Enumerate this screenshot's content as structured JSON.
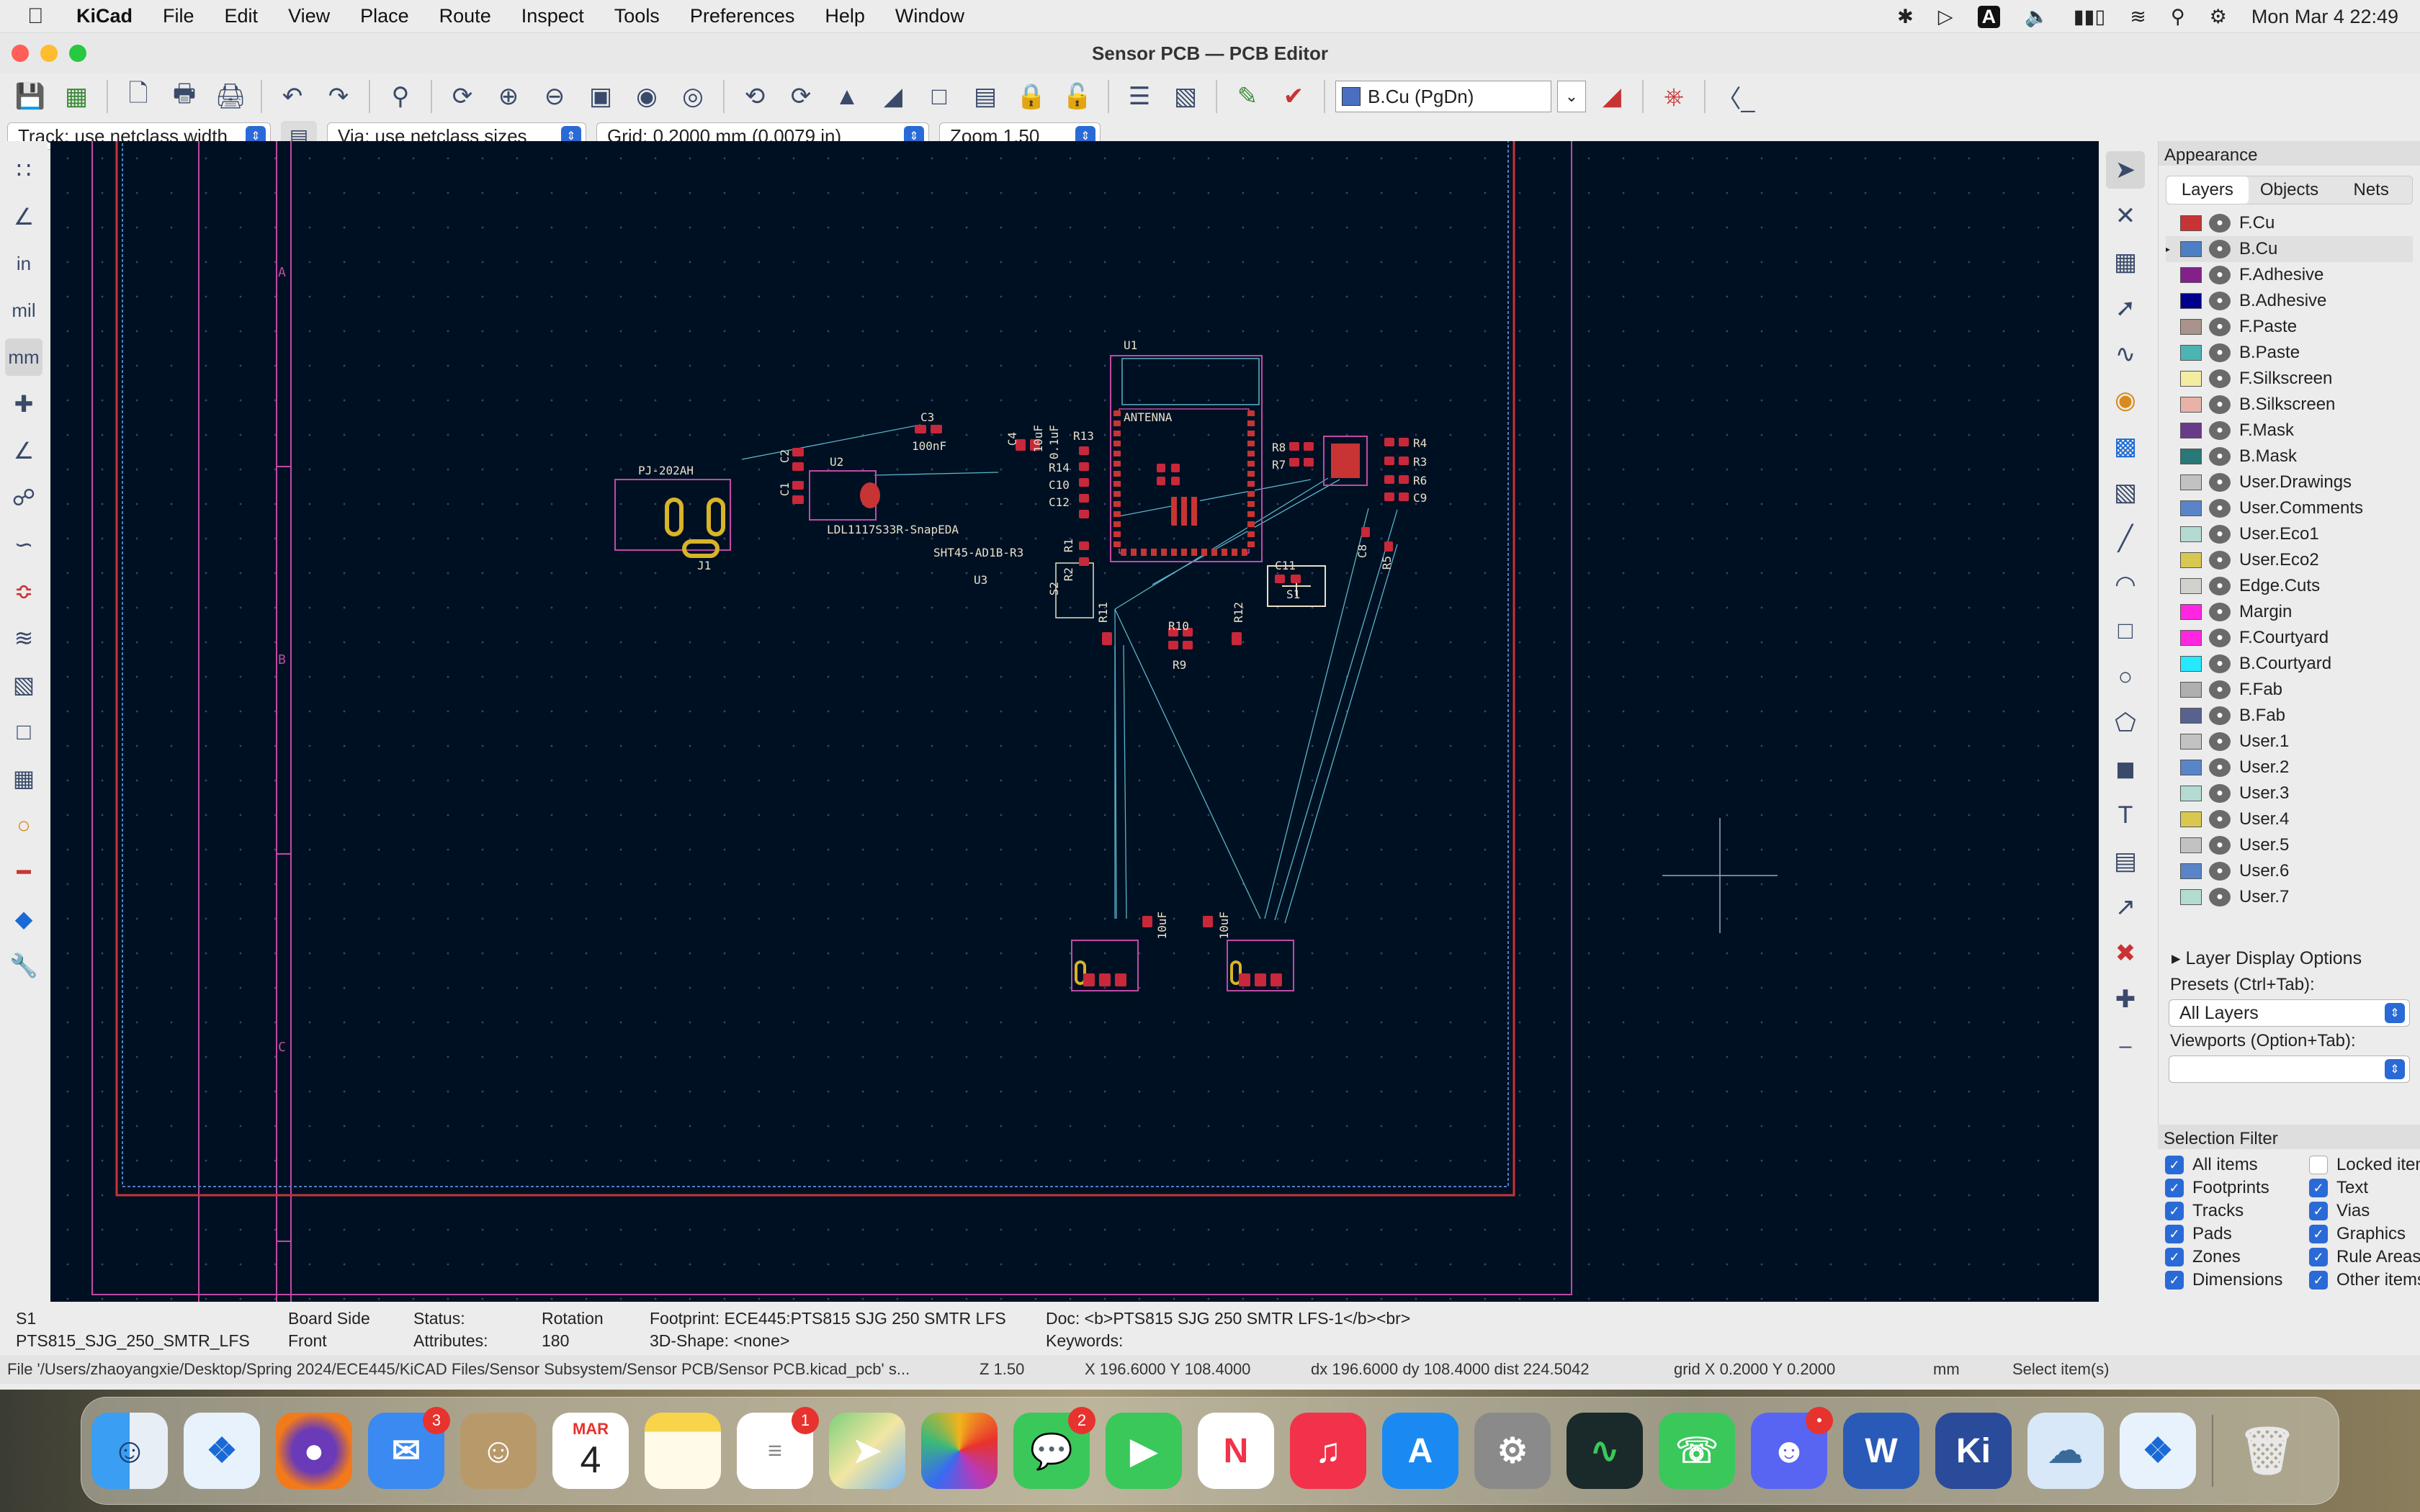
{
  "menubar": {
    "app_name": "KiCad",
    "items": [
      "File",
      "Edit",
      "View",
      "Place",
      "Route",
      "Inspect",
      "Tools",
      "Preferences",
      "Help",
      "Window"
    ],
    "input_indicator": "A",
    "clock": "Mon Mar 4  22:49"
  },
  "window": {
    "title": "Sensor PCB — PCB Editor"
  },
  "toolbar": {
    "active_layer": "B.Cu (PgDn)",
    "active_layer_color": "#4a6fc0"
  },
  "toolbar2": {
    "track": "Track: use netclass width",
    "via": "Via: use netclass sizes",
    "grid": "Grid: 0.2000 mm (0.0079 in)",
    "zoom": "Zoom 1.50"
  },
  "left_toolbar": {
    "unit_in": "in",
    "unit_mil": "mil",
    "unit_mm": "mm"
  },
  "canvas": {
    "sheet_markers": [
      "A",
      "B",
      "C"
    ],
    "labels": {
      "j1_value": "PJ-202AH",
      "j1_ref": "J1",
      "u2_ref": "U2",
      "u2_value": "LDL1117S33R-SnapEDA",
      "c2": "C2",
      "c1": "C1",
      "c3": "C3",
      "c3_value": "100nF",
      "u1": "U1",
      "antenna": "ANTENNA",
      "c4": "C4",
      "c4_value": "10uF",
      "c5_value": "0.1uF",
      "r13": "R13",
      "r14": "R14",
      "c10": "C10",
      "c12": "C12",
      "r1": "R1",
      "r2": "R2",
      "u3_value": "SHT45-AD1B-R3",
      "u3": "U3",
      "r8": "R8",
      "r7": "R7",
      "r4": "R4",
      "r3": "R3",
      "r6": "R6",
      "c9": "C9",
      "c8": "C8",
      "r5": "R5",
      "c11": "C11",
      "s1": "S1",
      "s2": "S2",
      "r11": "R11",
      "r10": "R10",
      "r9": "R9",
      "r12": "R12",
      "bottom_c1": "10uF",
      "bottom_c2": "10uF"
    }
  },
  "appearance": {
    "header": "Appearance",
    "tabs": [
      "Layers",
      "Objects",
      "Nets"
    ],
    "layers": [
      {
        "name": "F.Cu",
        "color": "#c83434"
      },
      {
        "name": "B.Cu",
        "color": "#4d7fc4"
      },
      {
        "name": "F.Adhesive",
        "color": "#84208a"
      },
      {
        "name": "B.Adhesive",
        "color": "#00008a"
      },
      {
        "name": "F.Paste",
        "color": "#a8948c"
      },
      {
        "name": "B.Paste",
        "color": "#4cb4b4"
      },
      {
        "name": "F.Silkscreen",
        "color": "#f2eda1"
      },
      {
        "name": "B.Silkscreen",
        "color": "#e8b2a7"
      },
      {
        "name": "F.Mask",
        "color": "#6a3a8a"
      },
      {
        "name": "B.Mask",
        "color": "#2a7878"
      },
      {
        "name": "User.Drawings",
        "color": "#c2c2c2"
      },
      {
        "name": "User.Comments",
        "color": "#5984c8"
      },
      {
        "name": "User.Eco1",
        "color": "#b4dbd2"
      },
      {
        "name": "User.Eco2",
        "color": "#d8c852"
      },
      {
        "name": "Edge.Cuts",
        "color": "#d0d2cd"
      },
      {
        "name": "Margin",
        "color": "#ff26e2"
      },
      {
        "name": "F.Courtyard",
        "color": "#ff26e2"
      },
      {
        "name": "B.Courtyard",
        "color": "#26e9ff"
      },
      {
        "name": "F.Fab",
        "color": "#afafaf"
      },
      {
        "name": "B.Fab",
        "color": "#58628f"
      },
      {
        "name": "User.1",
        "color": "#c2c2c2"
      },
      {
        "name": "User.2",
        "color": "#5984c8"
      },
      {
        "name": "User.3",
        "color": "#b4dbd2"
      },
      {
        "name": "User.4",
        "color": "#d8c852"
      },
      {
        "name": "User.5",
        "color": "#c2c2c2"
      },
      {
        "name": "User.6",
        "color": "#5984c8"
      },
      {
        "name": "User.7",
        "color": "#b4dbd2"
      }
    ],
    "layer_display_options": "Layer Display Options",
    "presets_label": "Presets (Ctrl+Tab):",
    "presets_value": "All Layers",
    "viewports_label": "Viewports (Option+Tab):",
    "viewports_value": ""
  },
  "selection_filter": {
    "header": "Selection Filter",
    "items": [
      {
        "label": "All items",
        "checked": true
      },
      {
        "label": "Locked items",
        "checked": false
      },
      {
        "label": "Footprints",
        "checked": true
      },
      {
        "label": "Text",
        "checked": true
      },
      {
        "label": "Tracks",
        "checked": true
      },
      {
        "label": "Vias",
        "checked": true
      },
      {
        "label": "Pads",
        "checked": true
      },
      {
        "label": "Graphics",
        "checked": true
      },
      {
        "label": "Zones",
        "checked": true
      },
      {
        "label": "Rule Areas",
        "checked": true
      },
      {
        "label": "Dimensions",
        "checked": true
      },
      {
        "label": "Other items",
        "checked": true
      }
    ]
  },
  "info": {
    "ref": "S1",
    "footprint_name": "PTS815_SJG_250_SMTR_LFS",
    "board_side_label": "Board Side",
    "board_side": "Front",
    "status_label": "Status:",
    "attributes_label": "Attributes:",
    "rotation_label": "Rotation",
    "rotation": "180",
    "footprint": "Footprint: ECE445:PTS815 SJG 250 SMTR LFS",
    "shape3d": "3D-Shape: <none>",
    "doc": "Doc: <b>PTS815 SJG 250 SMTR LFS-1</b><br>",
    "keywords": "Keywords:"
  },
  "statusbar": {
    "file": "File '/Users/zhaoyangxie/Desktop/Spring 2024/ECE445/KiCAD Files/Sensor Subsystem/Sensor PCB/Sensor PCB.kicad_pcb' s...",
    "zoom": "Z 1.50",
    "coords": "X 196.6000  Y 108.4000",
    "delta": "dx 196.6000  dy 108.4000  dist 224.5042",
    "grid": "grid X 0.2000  Y 0.2000",
    "units": "mm",
    "mode": "Select item(s)"
  },
  "dock": {
    "calendar_month": "MAR",
    "calendar_day": "4",
    "mail_badge": "1",
    "mail2_badge": "3",
    "reminders_badge": "1",
    "messages_badge": "2",
    "kicad_label": "Ki",
    "word_label": "W"
  }
}
